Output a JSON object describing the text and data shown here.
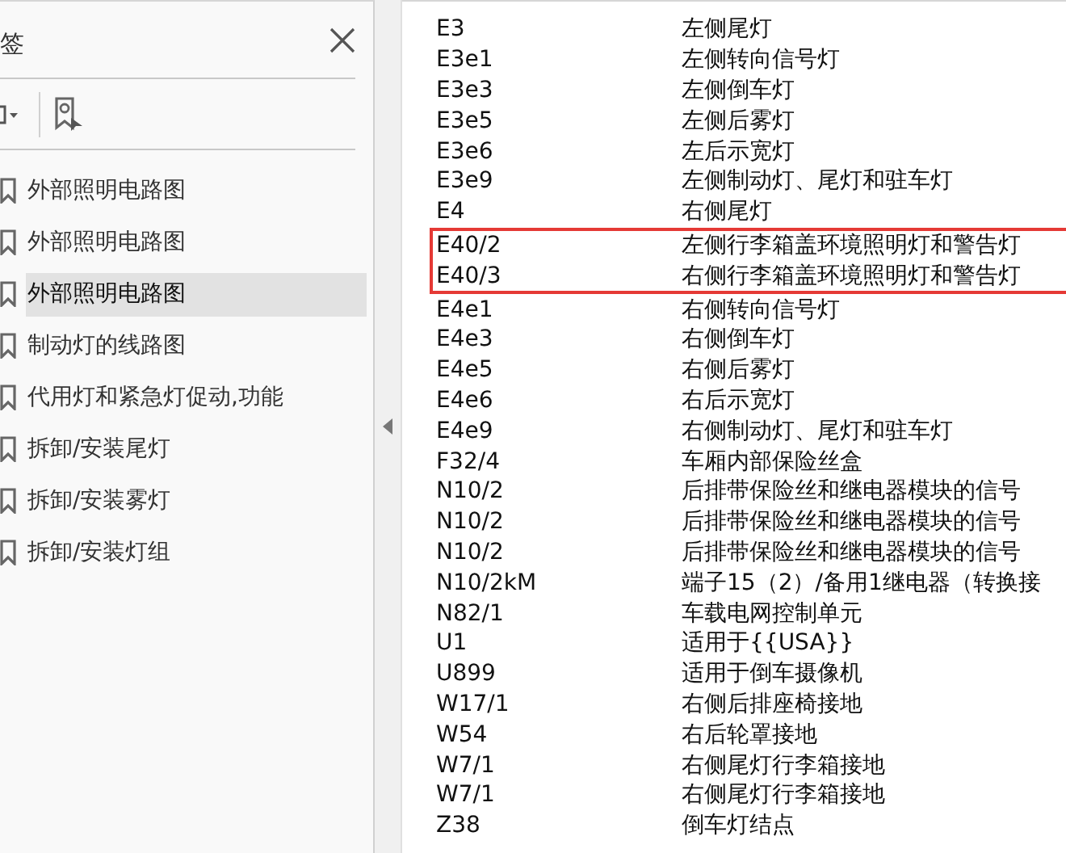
{
  "sidebar": {
    "title": "签",
    "items": [
      {
        "label": "外部照明电路图",
        "selected": false
      },
      {
        "label": "外部照明电路图",
        "selected": false
      },
      {
        "label": "外部照明电路图",
        "selected": true
      },
      {
        "label": "制动灯的线路图",
        "selected": false
      },
      {
        "label": "代用灯和紧急灯促动,功能",
        "selected": false
      },
      {
        "label": "拆卸/安装尾灯",
        "selected": false
      },
      {
        "label": "拆卸/安装雾灯",
        "selected": false
      },
      {
        "label": "拆卸/安装灯组",
        "selected": false
      }
    ]
  },
  "rows": [
    {
      "code": "E3",
      "text": "左侧尾灯",
      "highlighted": false
    },
    {
      "code": "E3e1",
      "text": "左侧转向信号灯",
      "highlighted": false
    },
    {
      "code": "E3e3",
      "text": "左侧倒车灯",
      "highlighted": false
    },
    {
      "code": "E3e5",
      "text": "左侧后雾灯",
      "highlighted": false
    },
    {
      "code": "E3e6",
      "text": "左后示宽灯",
      "highlighted": false
    },
    {
      "code": "E3e9",
      "text": "左侧制动灯、尾灯和驻车灯",
      "highlighted": false
    },
    {
      "code": "E4",
      "text": "右侧尾灯",
      "highlighted": false
    },
    {
      "code": "E40/2",
      "text": "左侧行李箱盖环境照明灯和警告灯",
      "highlighted": true
    },
    {
      "code": "E40/3",
      "text": "右侧行李箱盖环境照明灯和警告灯",
      "highlighted": true
    },
    {
      "code": "E4e1",
      "text": "右侧转向信号灯",
      "highlighted": false
    },
    {
      "code": "E4e3",
      "text": "右侧倒车灯",
      "highlighted": false
    },
    {
      "code": "E4e5",
      "text": "右侧后雾灯",
      "highlighted": false
    },
    {
      "code": "E4e6",
      "text": "右后示宽灯",
      "highlighted": false
    },
    {
      "code": "E4e9",
      "text": "右侧制动灯、尾灯和驻车灯",
      "highlighted": false
    },
    {
      "code": "F32/4",
      "text": "车厢内部保险丝盒",
      "highlighted": false
    },
    {
      "code": "N10/2",
      "text": "后排带保险丝和继电器模块的信号",
      "highlighted": false
    },
    {
      "code": "N10/2",
      "text": "后排带保险丝和继电器模块的信号",
      "highlighted": false
    },
    {
      "code": "N10/2",
      "text": "后排带保险丝和继电器模块的信号",
      "highlighted": false
    },
    {
      "code": "N10/2kM",
      "text": "端子15（2）/备用1继电器（转换接",
      "highlighted": false
    },
    {
      "code": "N82/1",
      "text": "车载电网控制单元",
      "highlighted": false
    },
    {
      "code": "U1",
      "text": "适用于{{USA}}",
      "highlighted": false
    },
    {
      "code": "U899",
      "text": "适用于倒车摄像机",
      "highlighted": false
    },
    {
      "code": "W17/1",
      "text": "右侧后排座椅接地",
      "highlighted": false
    },
    {
      "code": "W54",
      "text": "右后轮罩接地",
      "highlighted": false
    },
    {
      "code": "W7/1",
      "text": "右侧尾灯行李箱接地",
      "highlighted": false
    },
    {
      "code": "W7/1",
      "text": "右侧尾灯行李箱接地",
      "highlighted": false
    },
    {
      "code": "Z38",
      "text": "倒车灯结点",
      "highlighted": false
    }
  ]
}
